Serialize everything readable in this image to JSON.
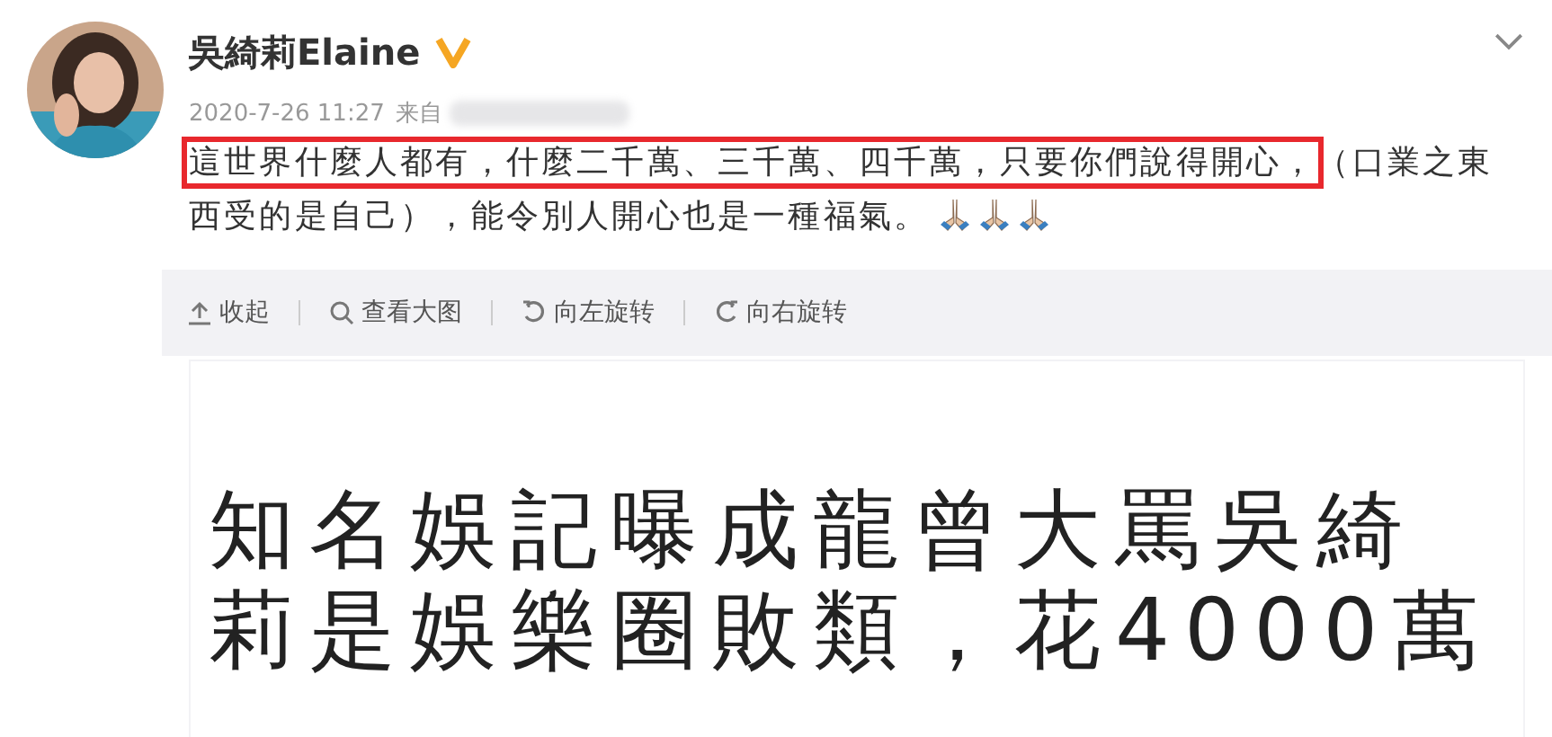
{
  "post": {
    "author": "吳綺莉Elaine",
    "verified": true,
    "time": "2020-7-26 11:27",
    "source_label": "来自",
    "text": [
      {
        "text": "這世界什麼人都有，什麼二千萬、三千萬、四千萬，只要你們說得開心，",
        "boxed": true
      },
      {
        "text": "（口業之東西受的是自己），能令別人開心也是一種福氣。",
        "boxed": false
      }
    ],
    "emojis": [
      {
        "kind": "praying_hands"
      },
      {
        "kind": "praying_hands"
      },
      {
        "kind": "praying_hands"
      }
    ]
  },
  "toolbar": [
    {
      "kind": "collapse",
      "label": "收起"
    },
    {
      "kind": "zoom",
      "label": "查看大图"
    },
    {
      "kind": "rotate_left",
      "label": "向左旋转"
    },
    {
      "kind": "rotate_right",
      "label": "向右旋转"
    }
  ],
  "image": {
    "lines": [
      "知名娛記曝成龍曾大罵吳綺",
      "莉是娛樂圈敗類，花4000萬"
    ]
  }
}
